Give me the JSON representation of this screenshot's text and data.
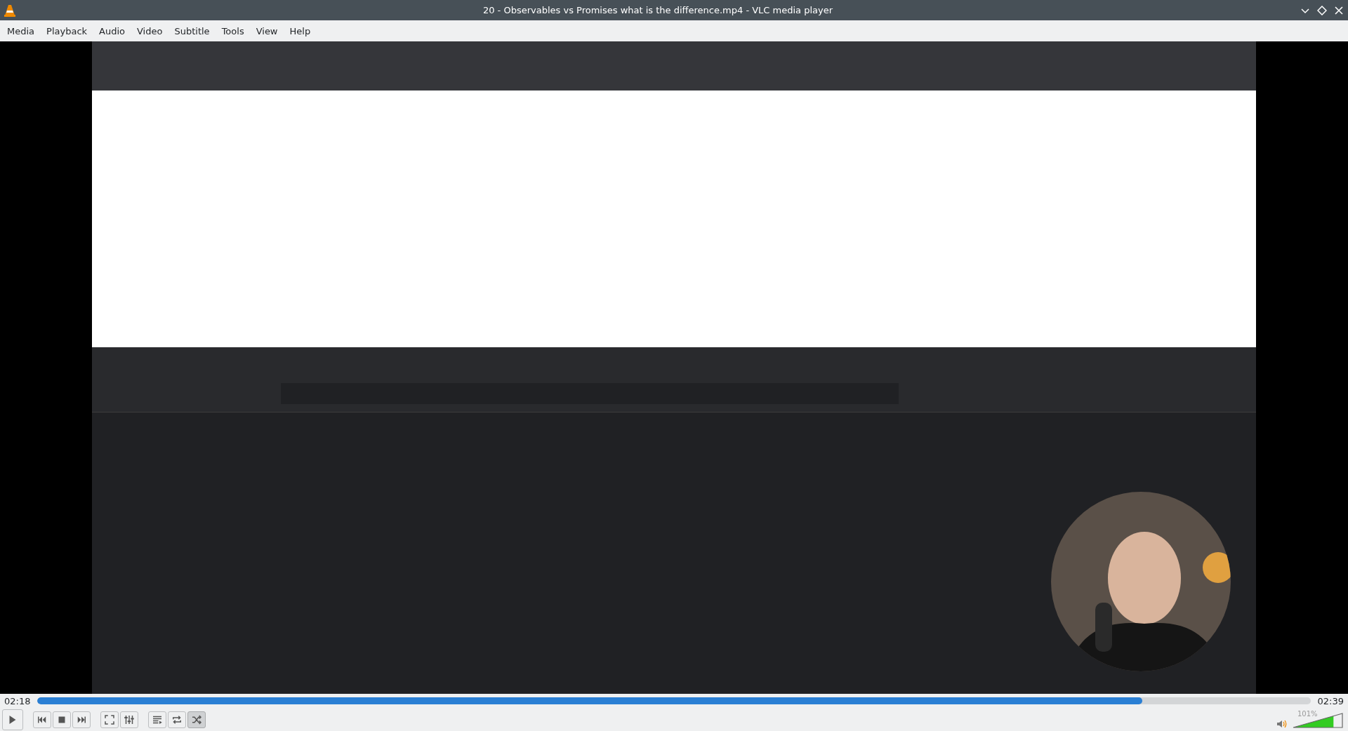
{
  "window": {
    "title": "20 - Observables vs Promises what is the difference.mp4 - VLC media player"
  },
  "menu": [
    "Media",
    "Playback",
    "Audio",
    "Video",
    "Subtitle",
    "Tools",
    "View",
    "Help"
  ],
  "seek": {
    "elapsed": "02:18",
    "total": "02:39",
    "level": 0.868
  },
  "buttons": [
    {
      "kind": "play"
    },
    {
      "kind": "prev"
    },
    {
      "kind": "stop"
    },
    {
      "kind": "next"
    },
    {
      "kind": "fullscreen"
    },
    {
      "kind": "extended"
    },
    {
      "kind": "playlist"
    }
  ],
  "toggles": [
    {
      "kind": "loop",
      "on": false
    },
    {
      "kind": "random",
      "on": true
    }
  ],
  "volume": {
    "reading": "101%",
    "level": 0.81
  }
}
